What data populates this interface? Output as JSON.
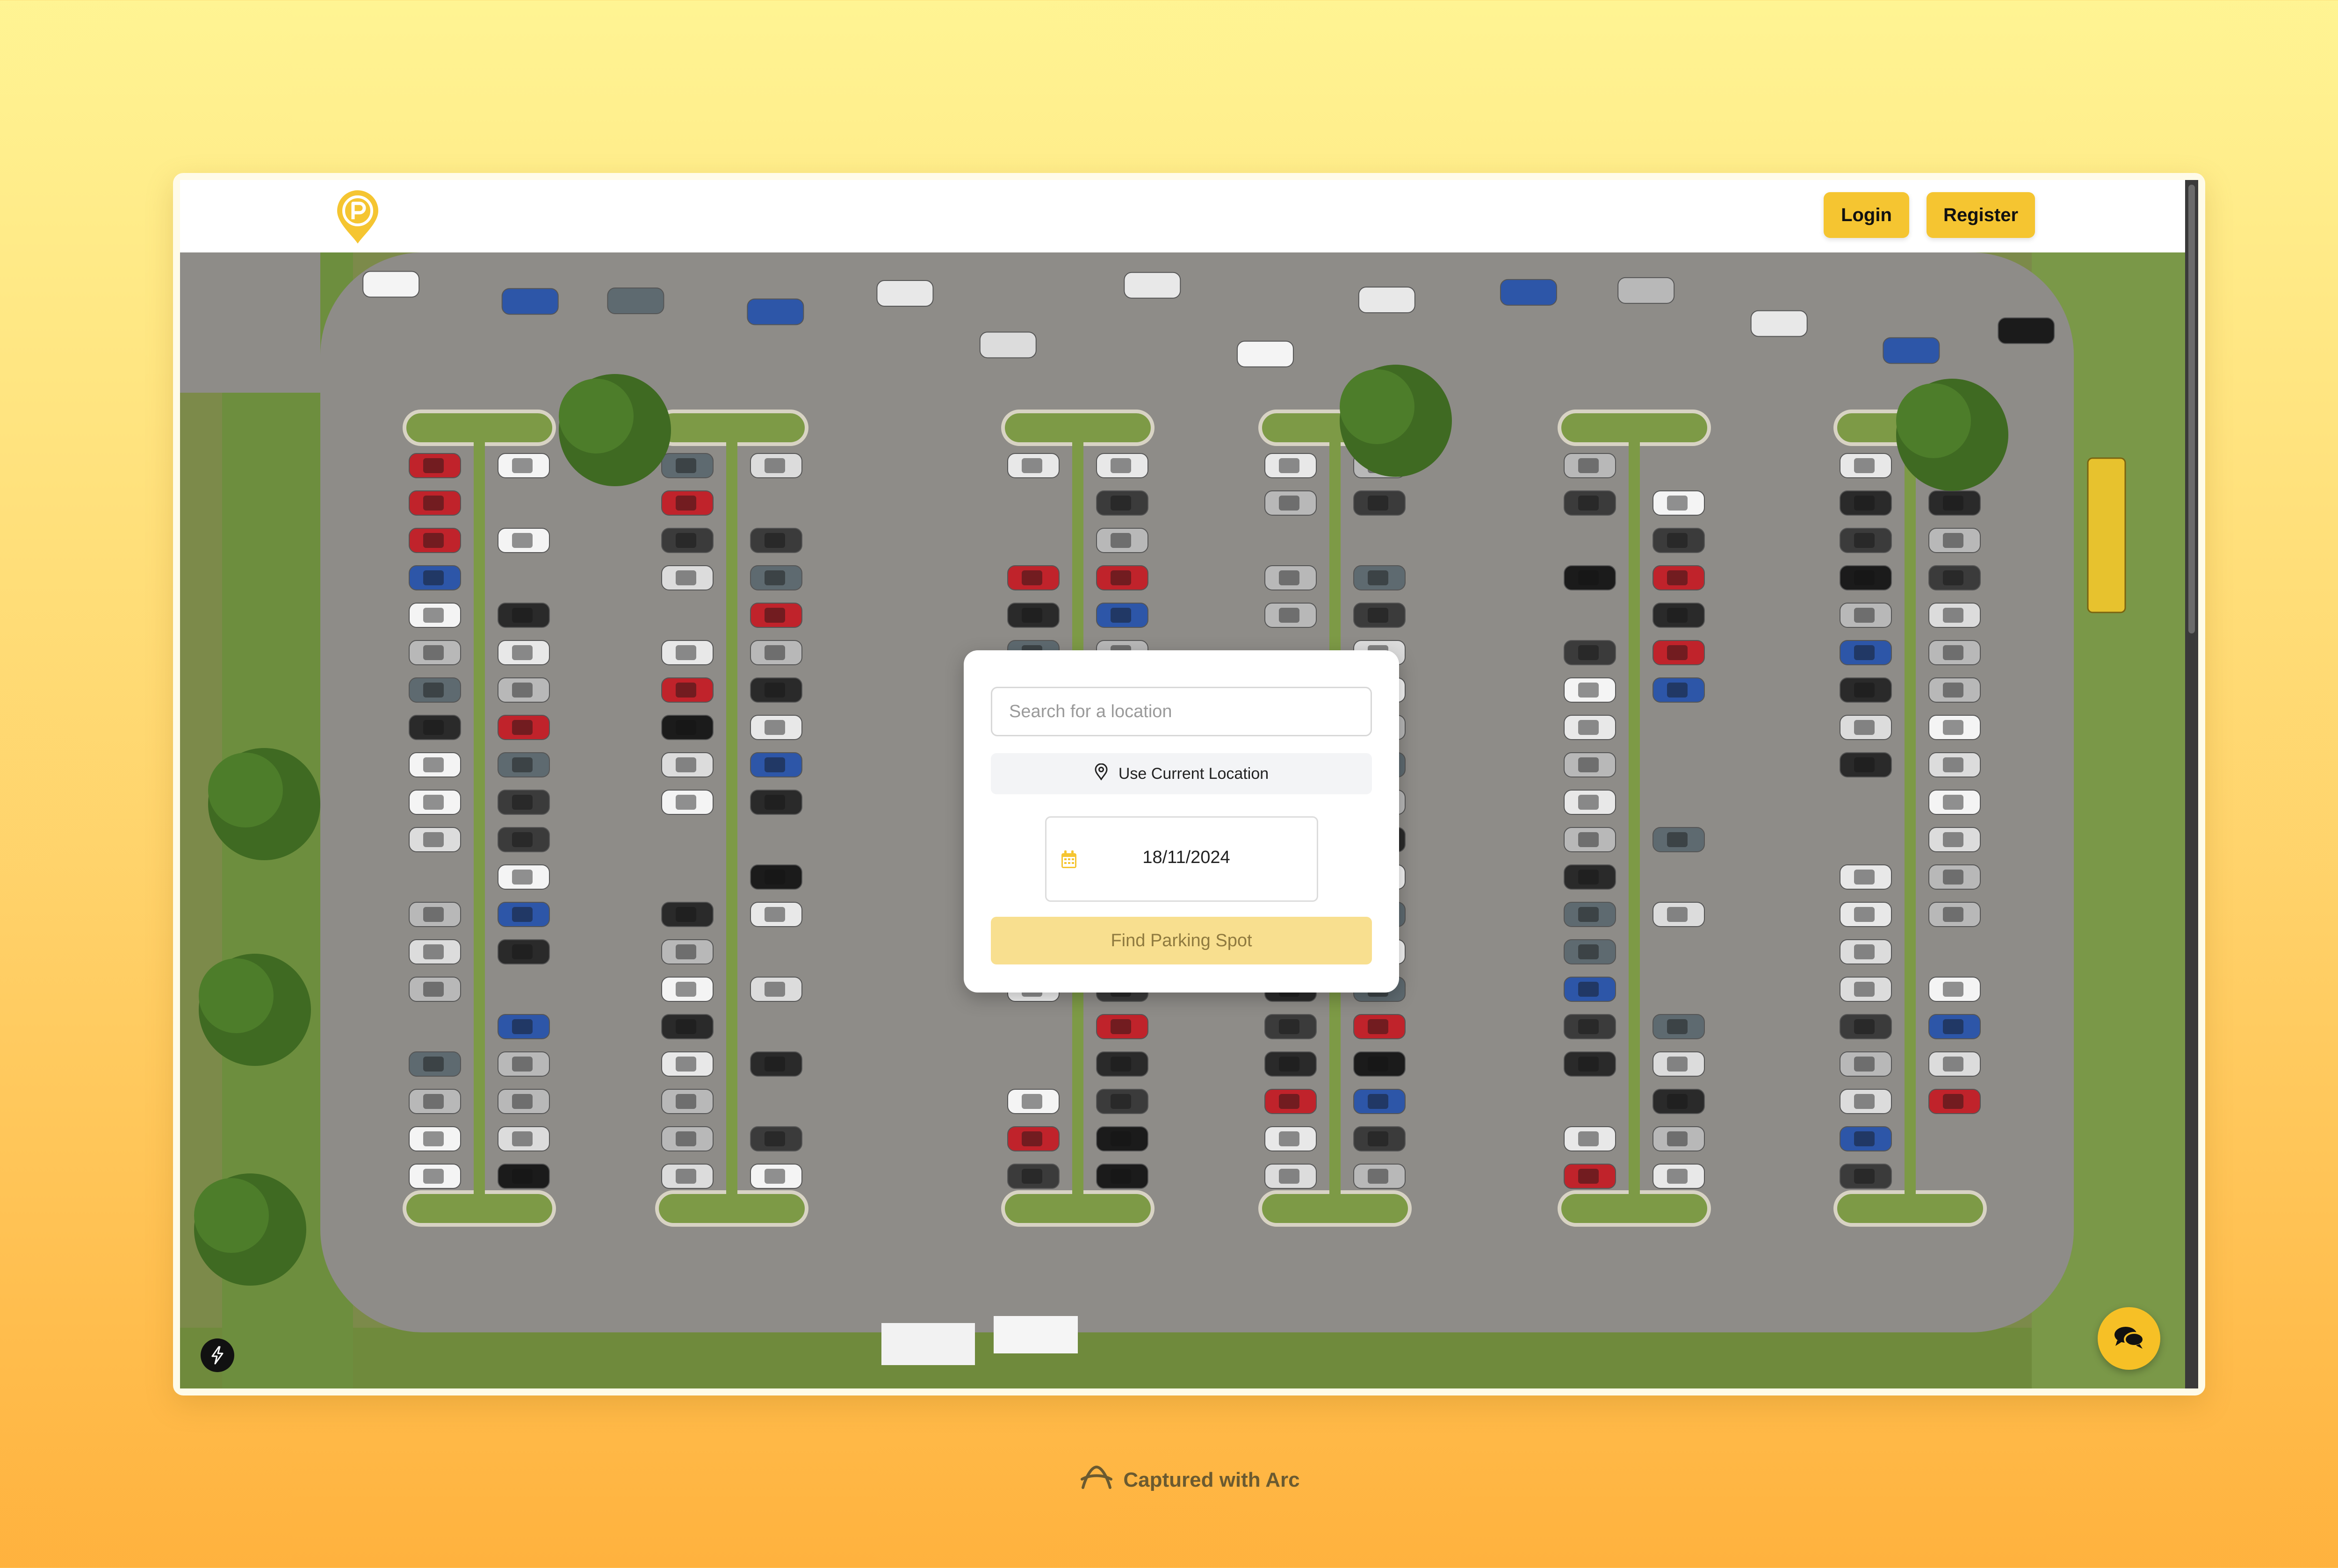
{
  "header": {
    "logo_icon": "parking-pin-icon",
    "login_label": "Login",
    "register_label": "Register"
  },
  "hero": {
    "background": "aerial-parking-lot-photo"
  },
  "search": {
    "placeholder": "Search for a location",
    "use_location_label": "Use Current Location",
    "date_value": "18/11/2024",
    "submit_label": "Find Parking Spot"
  },
  "icons": {
    "location": "map-pin-icon",
    "calendar": "calendar-icon",
    "chat": "chat-bubbles-icon",
    "bolt": "lightning-bolt-icon"
  },
  "footer": {
    "capture_label": "Captured with Arc"
  },
  "colors": {
    "accent": "#f5c531",
    "accent_muted": "#f8df8f",
    "background_top": "#fff493",
    "background_bottom": "#ffb23e"
  }
}
